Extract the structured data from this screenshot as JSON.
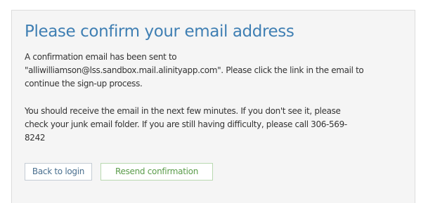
{
  "title": "Please confirm your email address",
  "message": {
    "line1": "A confirmation email has been sent to",
    "line2": "\"alliwilliamson@lss.sandbox.mail.alinityapp.com\". Please click the link in the email to",
    "line3": "continue the sign-up process."
  },
  "info": {
    "line1": "You should receive the email in the next few minutes. If you don't see it, please",
    "line2": "check your junk email folder. If you are still having difficulty, please call 306-569-",
    "line3": "8242"
  },
  "buttons": {
    "back_label": "Back to login",
    "resend_label": "Resend confirmation"
  },
  "colors": {
    "title": "#3f7fb3",
    "panel_background": "#f5f5f5",
    "resend_text": "#5a9c4a",
    "back_text": "#4a6f8f"
  }
}
